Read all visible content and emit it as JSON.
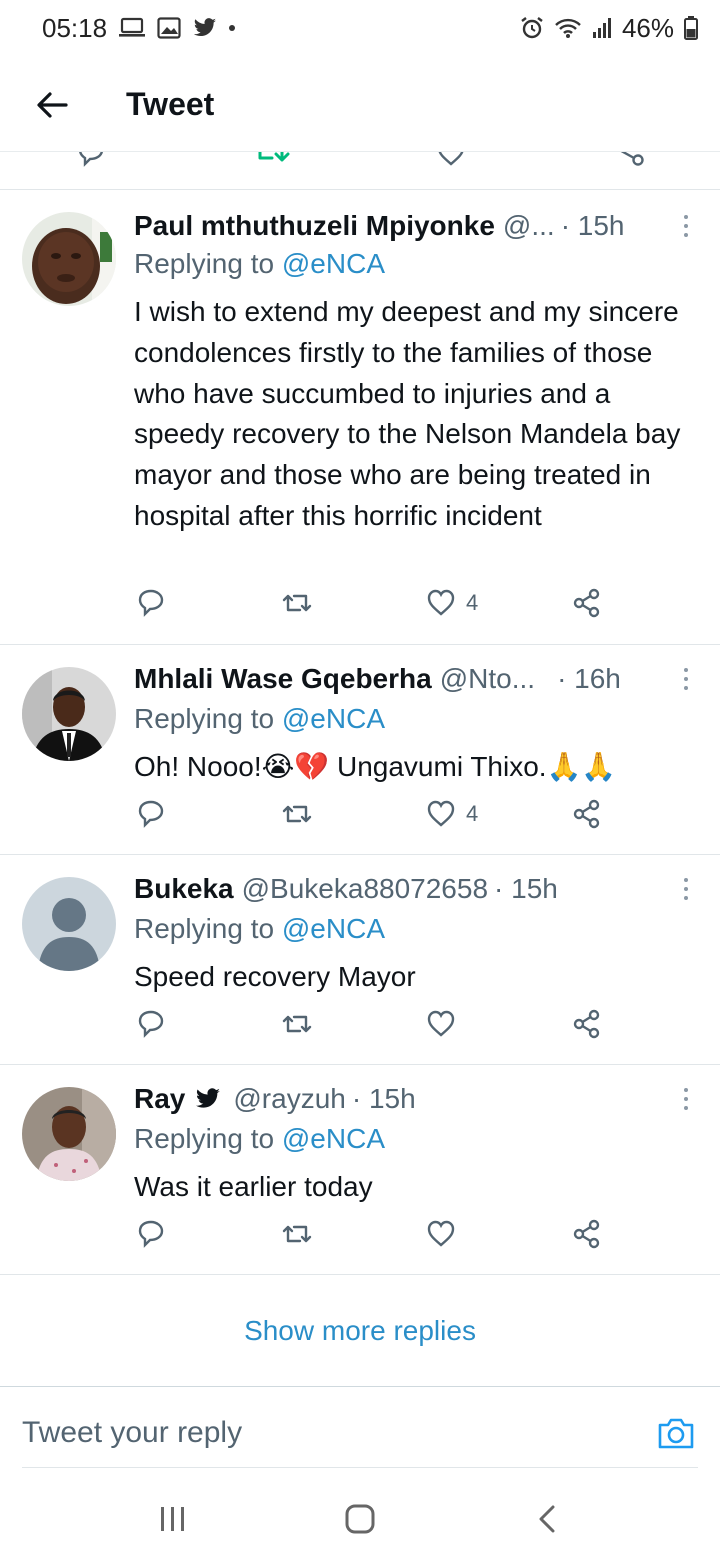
{
  "status_bar": {
    "time": "05:18",
    "battery": "46%",
    "icons": [
      "laptop-icon",
      "image-icon",
      "twitter-icon",
      "alarm-icon",
      "wifi-icon",
      "signal-icon",
      "battery-icon"
    ]
  },
  "header": {
    "title": "Tweet"
  },
  "replies": [
    {
      "name": "Paul mthuthuzeli Mpiyonke",
      "handle": "@...",
      "time": "· 15h",
      "replying_label": "Replying to ",
      "replying_to": "@eNCA",
      "text": "I wish to extend my deepest and my sincere condolences firstly to the families of those who have succumbed to injuries and a speedy recovery to the Nelson Mandela bay mayor and those who are being treated in hospital after this horrific incident",
      "likes": "4"
    },
    {
      "name": "Mhlali Wase Gqeberha",
      "handle": "@Nto...",
      "time": "· 16h",
      "replying_label": "Replying to ",
      "replying_to": "@eNCA",
      "text": "Oh! Nooo!😭💔 Ungavumi Thixo.🙏🙏",
      "likes": "4"
    },
    {
      "name": "Bukeka",
      "handle": "@Bukeka88072658",
      "time": "· 15h",
      "replying_label": "Replying to ",
      "replying_to": "@eNCA",
      "text": "Speed recovery Mayor",
      "likes": ""
    },
    {
      "name": "Ray",
      "handle": "@rayzuh",
      "time": "· 15h",
      "replying_label": "Replying to ",
      "replying_to": "@eNCA",
      "text": "Was it earlier today",
      "likes": ""
    }
  ],
  "show_more": "Show more replies",
  "compose": {
    "placeholder": "Tweet your reply"
  },
  "colors": {
    "accent": "#1d9bf0",
    "muted": "#536471",
    "retweet_green": "#00ba7c"
  }
}
